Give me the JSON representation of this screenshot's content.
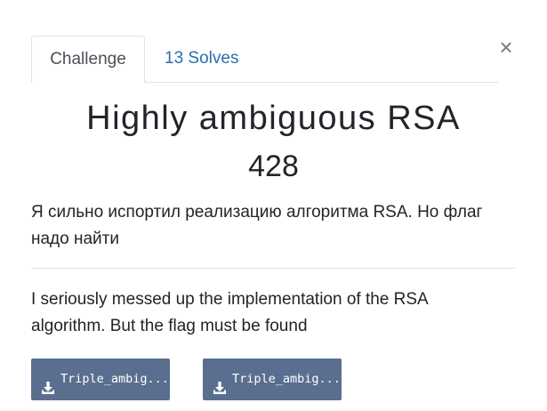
{
  "tabs": {
    "challenge_label": "Challenge",
    "solves_label": "13 Solves"
  },
  "close": {
    "symbol": "×"
  },
  "challenge": {
    "title": "Highly ambiguous RSA",
    "points": "428",
    "description_ru_line1": "Я сильно испортил реализацию алгоритма RSA. Но флаг",
    "description_ru_line2": "надо найти",
    "description_en_line1": "I seriously messed up the implementation of the RSA",
    "description_en_line2": "algorithm. But the flag must be found"
  },
  "files": [
    {
      "label": "Triple_ambig...",
      "icon": "download-icon"
    },
    {
      "label": "Triple_ambig...",
      "icon": "download-icon"
    }
  ],
  "colors": {
    "tab_link": "#2a6fad",
    "file_button_bg": "#5a6f8f",
    "close_icon": "#7a7a7a"
  }
}
